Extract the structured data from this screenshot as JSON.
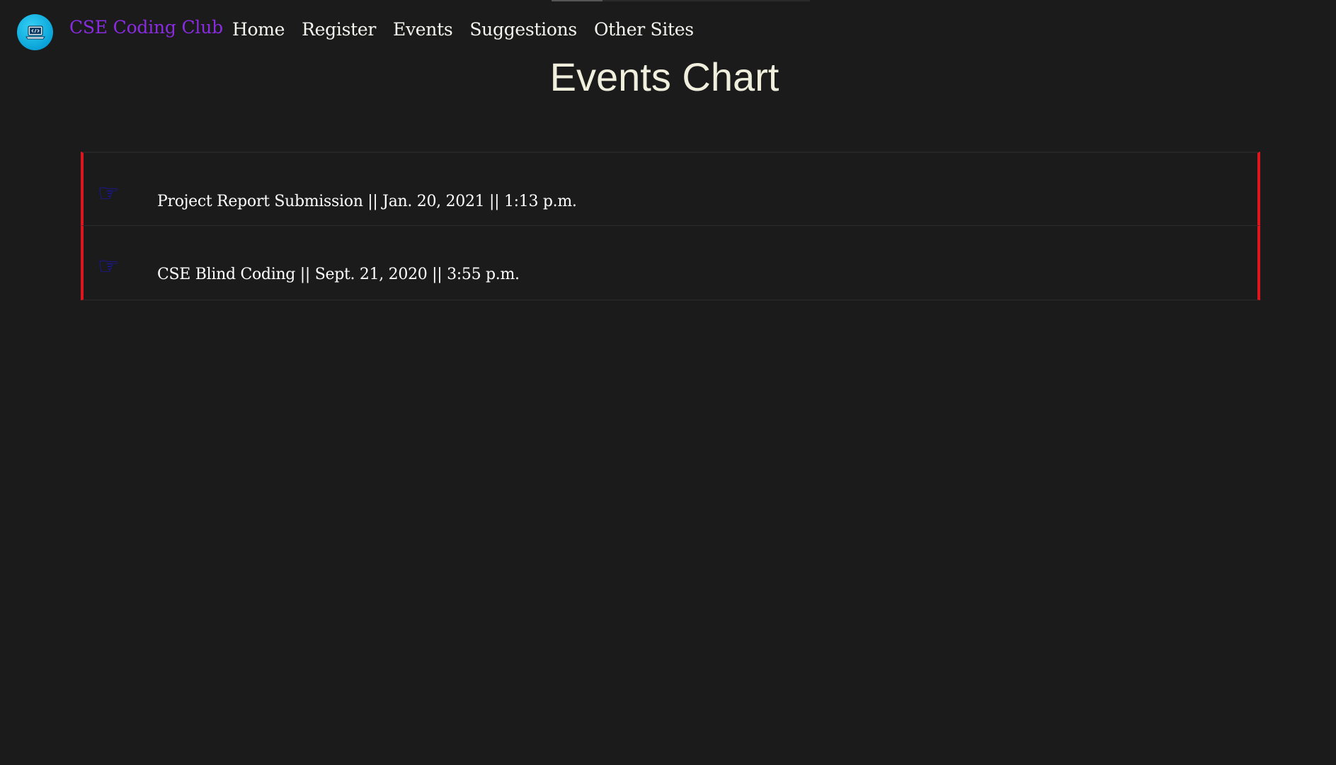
{
  "nav": {
    "brand": "CSE Coding Club",
    "logo_icon": "laptop-code-icon",
    "links": [
      "Home",
      "Register",
      "Events",
      "Suggestions",
      "Other Sites"
    ]
  },
  "page": {
    "title": "Events Chart"
  },
  "events": [
    {
      "icon": "pointing-hand-icon",
      "text": "Project Report Submission || Jan. 20, 2021 || 1:13 p.m."
    },
    {
      "icon": "pointing-hand-icon",
      "text": "CSE Blind Coding || Sept. 21, 2020 || 3:55 p.m."
    }
  ],
  "colors": {
    "background": "#1b1b1b",
    "brand": "#8a2be2",
    "accent_border": "#e0161e",
    "hand_icon": "#1c14c8",
    "title": "#f0eedc"
  }
}
